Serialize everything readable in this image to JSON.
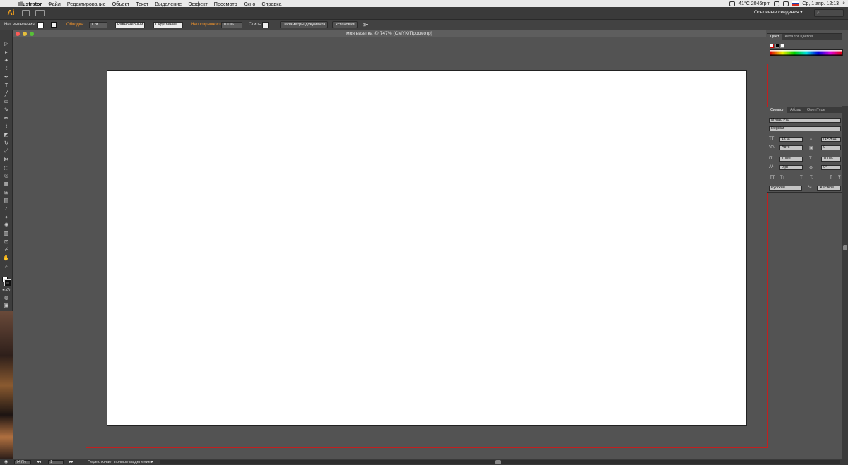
{
  "menubar": {
    "app": "Illustrator",
    "items": [
      "Файл",
      "Редактирование",
      "Объект",
      "Текст",
      "Выделение",
      "Эффект",
      "Просмотр",
      "Окно",
      "Справка"
    ],
    "clock": "Ср, 1 апр. 12:13",
    "weather": "41°C",
    "rpm": "2046rpm"
  },
  "appbar": {
    "logo": "Ai",
    "workspace": "Основные сведения",
    "search_icon": "⌕"
  },
  "control": {
    "no_selection": "Нет выделения",
    "stroke_label": "Обводка:",
    "stroke_value": "1 pt",
    "uniform": "Равномерный",
    "round": "Скругление",
    "opacity_label": "Непрозрачность:",
    "opacity_value": "100%",
    "style_label": "Стиль:",
    "doc_settings": "Параметры документа",
    "preferences": "Установки"
  },
  "document": {
    "title": "моя визитка @ 747% (CMYK/Просмотр)"
  },
  "color_panel": {
    "tabs": [
      "Цвет",
      "Каталог цветов"
    ]
  },
  "char_panel": {
    "tabs": [
      "Символ",
      "Абзац",
      "OpenType"
    ],
    "font": "Myriad Pro",
    "style": "Regular",
    "size": "12 pt",
    "leading": "(14,4 pt)",
    "kerning": "Авто",
    "tracking": "0",
    "vscale": "100%",
    "hscale": "100%",
    "baseline": "0 pt",
    "rotation": "0°",
    "language": "Русский",
    "antialias": "Жесткое",
    "tt_buttons": [
      "TT",
      "Tт",
      "T'",
      "T,",
      "T",
      "Ŧ"
    ]
  },
  "status": {
    "zoom": "747%",
    "page": "1",
    "message": "Переключает прямое выделение"
  },
  "colors": {
    "accent_orange": "#f0922b",
    "bleed_red": "#c02020",
    "artboard": "#ffffff",
    "pasteboard": "#535353"
  }
}
